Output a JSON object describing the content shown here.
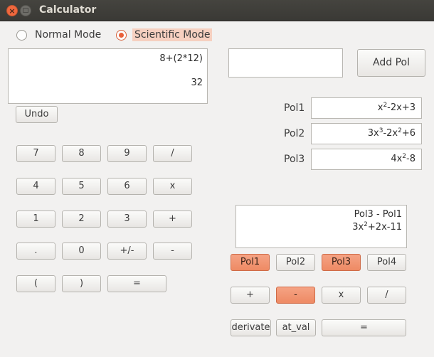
{
  "window": {
    "title": "Calculator"
  },
  "mode": {
    "normal_label": "Normal Mode",
    "scientific_label": "Scientific Mode",
    "selected": "Scientific Mode"
  },
  "display": {
    "expression": "8+(2*12)",
    "result": "32"
  },
  "undo_label": "Undo",
  "keypad": [
    [
      "7",
      "8",
      "9",
      "/"
    ],
    [
      "4",
      "5",
      "6",
      "x"
    ],
    [
      "1",
      "2",
      "3",
      "+"
    ],
    [
      ".",
      "0",
      "+/-",
      "-"
    ],
    [
      "(",
      ")",
      "="
    ]
  ],
  "poly": {
    "input_value": "",
    "add_label": "Add Pol",
    "fields": [
      {
        "label": "Pol1",
        "value": "x^2-2x+3"
      },
      {
        "label": "Pol2",
        "value": "3x^3-2x^2+6"
      },
      {
        "label": "Pol3",
        "value": "4x^2-8"
      }
    ],
    "output": {
      "expression": "Pol3 - Pol1",
      "result": "3x^2+2x-11"
    },
    "select_buttons": [
      {
        "label": "Pol1",
        "active": true
      },
      {
        "label": "Pol2",
        "active": false
      },
      {
        "label": "Pol3",
        "active": true
      },
      {
        "label": "Pol4",
        "active": false
      }
    ],
    "op_buttons": [
      {
        "label": "+",
        "active": false
      },
      {
        "label": "-",
        "active": true
      },
      {
        "label": "x",
        "active": false
      },
      {
        "label": "/",
        "active": false
      }
    ],
    "func_buttons": [
      "derivate",
      "at_val",
      "="
    ]
  },
  "colors": {
    "accent": "#ee8a64",
    "titlebar": "#3c3b37",
    "close": "#f0683e"
  }
}
